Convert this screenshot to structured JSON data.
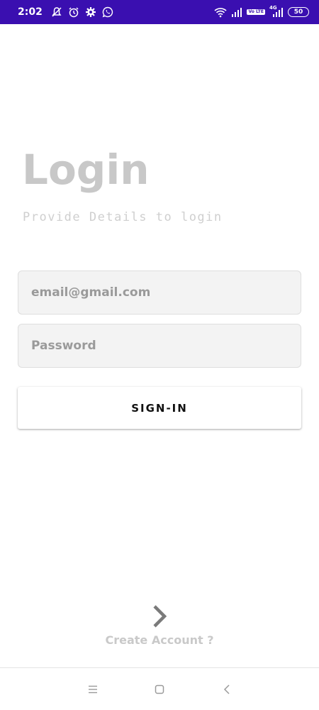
{
  "status_bar": {
    "time": "2:02",
    "network_label": "4G",
    "volte_label": "Vo LTE",
    "battery": "50",
    "background": "#3a0fb0"
  },
  "login": {
    "title": "Login",
    "subtitle": "Provide Details to login",
    "email_placeholder": "email@gmail.com",
    "password_placeholder": "Password",
    "signin_label": "SIGN-IN"
  },
  "footer": {
    "create_account_label": "Create Account ?"
  },
  "icons": {
    "status_left": [
      "mute-icon",
      "alarm-icon",
      "settings-icon",
      "whatsapp-icon"
    ],
    "status_right": [
      "wifi-icon",
      "signal-icon",
      "volte-icon",
      "signal-4g-icon",
      "battery-icon"
    ],
    "nav": [
      "menu-icon",
      "home-icon",
      "back-icon"
    ]
  }
}
